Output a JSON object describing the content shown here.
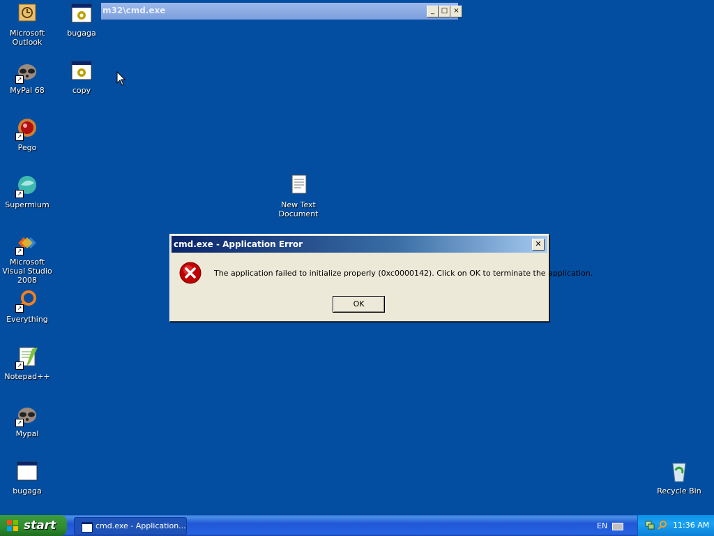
{
  "desktop": {
    "icons": [
      {
        "label": "Microsoft Outlook"
      },
      {
        "label": "bugaga"
      },
      {
        "label": "MyPal 68"
      },
      {
        "label": "copy"
      },
      {
        "label": "Pego"
      },
      {
        "label": "Supermium"
      },
      {
        "label": "New Text Document"
      },
      {
        "label": "Microsoft Visual Studio 2008"
      },
      {
        "label": "Everything"
      },
      {
        "label": "Notepad++"
      },
      {
        "label": "Mypal"
      },
      {
        "label": "bugaga"
      },
      {
        "label": "Recycle Bin"
      }
    ]
  },
  "background_window": {
    "title": "m32\\cmd.exe",
    "minimize": "_",
    "maximize": "□",
    "close": "×"
  },
  "dialog": {
    "title": "cmd.exe - Application Error",
    "close": "✕",
    "message": "The application failed to initialize properly (0xc0000142). Click on OK to terminate the application.",
    "ok_label": "OK",
    "icon": "error-icon"
  },
  "taskbar": {
    "start_label": "start",
    "task_button": "cmd.exe - Application...",
    "language": "EN",
    "clock": "11:36 AM"
  },
  "colors": {
    "desktop": "#034ea1",
    "taskbar": "#245edb",
    "start": "#2e8b2e",
    "dialog_bg": "#ece9d8"
  }
}
